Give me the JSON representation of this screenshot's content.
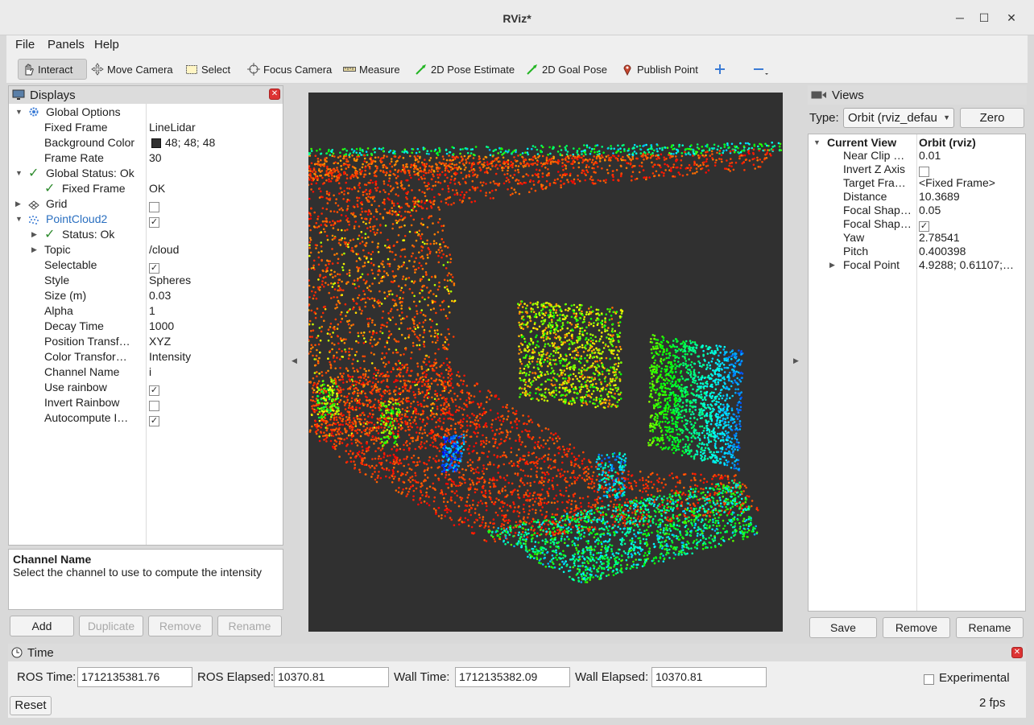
{
  "window": {
    "title": "RViz*"
  },
  "menu": {
    "file": "File",
    "panels": "Panels",
    "help": "Help"
  },
  "toolbar": {
    "interact": "Interact",
    "move_camera": "Move Camera",
    "select": "Select",
    "focus_camera": "Focus Camera",
    "measure": "Measure",
    "pose_estimate": "2D Pose Estimate",
    "goal_pose": "2D Goal Pose",
    "publish_point": "Publish Point"
  },
  "displays": {
    "title": "Displays",
    "rows": [
      {
        "label": "Global Options",
        "value": ""
      },
      {
        "label": "Fixed Frame",
        "value": "LineLidar"
      },
      {
        "label": "Background Color",
        "value": "48; 48; 48"
      },
      {
        "label": "Frame Rate",
        "value": "30"
      },
      {
        "label": "Global Status: Ok",
        "value": ""
      },
      {
        "label": "Fixed Frame",
        "value": "OK"
      },
      {
        "label": "Grid",
        "value": ""
      },
      {
        "label": "PointCloud2",
        "value": ""
      },
      {
        "label": "Status: Ok",
        "value": ""
      },
      {
        "label": "Topic",
        "value": "/cloud"
      },
      {
        "label": "Selectable",
        "value": ""
      },
      {
        "label": "Style",
        "value": "Spheres"
      },
      {
        "label": "Size (m)",
        "value": "0.03"
      },
      {
        "label": "Alpha",
        "value": "1"
      },
      {
        "label": "Decay Time",
        "value": "1000"
      },
      {
        "label": "Position Transf…",
        "value": "XYZ"
      },
      {
        "label": "Color Transfor…",
        "value": "Intensity"
      },
      {
        "label": "Channel Name",
        "value": "i"
      },
      {
        "label": "Use rainbow",
        "value": ""
      },
      {
        "label": "Invert Rainbow",
        "value": ""
      },
      {
        "label": "Autocompute I…",
        "value": ""
      }
    ],
    "checks": {
      "grid": false,
      "pointcloud2": true,
      "selectable": true,
      "use_rainbow": true,
      "invert_rainbow": false,
      "autocompute": true
    },
    "background_color": "#303030",
    "help_title": "Channel Name",
    "help_text": "Select the channel to use to compute the intensity",
    "buttons": {
      "add": "Add",
      "duplicate": "Duplicate",
      "remove": "Remove",
      "rename": "Rename"
    }
  },
  "views": {
    "title": "Views",
    "type_label": "Type:",
    "type_value": "Orbit (rviz_defau",
    "zero": "Zero",
    "current_view_label": "Current View",
    "current_view_value": "Orbit (rviz)",
    "rows": [
      {
        "label": "Near Clip …",
        "value": "0.01"
      },
      {
        "label": "Invert Z Axis",
        "value": ""
      },
      {
        "label": "Target Fra…",
        "value": "<Fixed Frame>"
      },
      {
        "label": "Distance",
        "value": "10.3689"
      },
      {
        "label": "Focal Shap…",
        "value": "0.05"
      },
      {
        "label": "Focal Shap…",
        "value": ""
      },
      {
        "label": "Yaw",
        "value": "2.78541"
      },
      {
        "label": "Pitch",
        "value": "0.400398"
      },
      {
        "label": "Focal Point",
        "value": "4.9288; 0.61107;…"
      }
    ],
    "checks": {
      "invert_z": false,
      "focal_shape_fixed": true
    },
    "buttons": {
      "save": "Save",
      "remove": "Remove",
      "rename": "Rename"
    }
  },
  "time": {
    "title": "Time",
    "ros_time_label": "ROS Time:",
    "ros_time": "1712135381.76",
    "ros_elapsed_label": "ROS Elapsed:",
    "ros_elapsed": "10370.81",
    "wall_time_label": "Wall Time:",
    "wall_time": "1712135382.09",
    "wall_elapsed_label": "Wall Elapsed:",
    "wall_elapsed": "10370.81",
    "experimental_label": "Experimental",
    "experimental": false,
    "reset": "Reset",
    "fps": "2 fps"
  },
  "colors": {
    "accent_blue": "#2a6fc0",
    "ok_green": "#2e8b2e",
    "close_red": "#d33333",
    "viewport_bg": "#303030"
  }
}
